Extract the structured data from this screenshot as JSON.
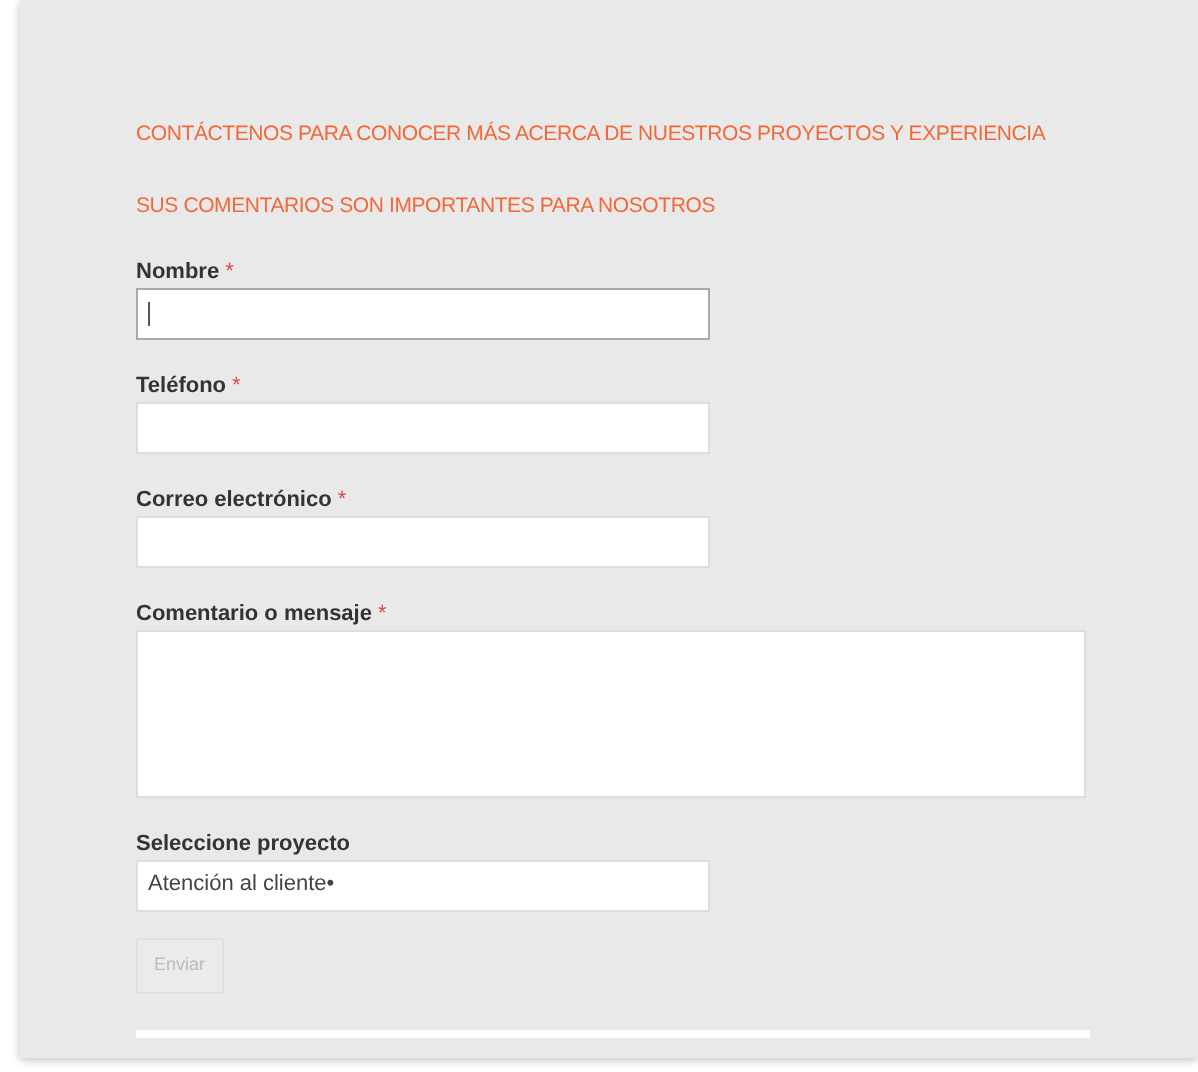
{
  "headings": [
    "CONTÁCTENOS PARA CONOCER MÁS ACERCA DE NUESTROS PROYECTOS Y EXPERIENCIA",
    "SUS COMENTARIOS SON IMPORTANTES PARA NOSOTROS"
  ],
  "fields": [
    {
      "kind": "text",
      "label": "Nombre",
      "required_mark": "*",
      "focused": true
    },
    {
      "kind": "text",
      "label": "Teléfono",
      "required_mark": "*",
      "focused": false
    },
    {
      "kind": "text",
      "label": "Correo electrónico",
      "required_mark": "*",
      "focused": false
    },
    {
      "kind": "textarea",
      "label": "Comentario o mensaje",
      "required_mark": "*",
      "focused": false
    },
    {
      "kind": "select",
      "label": "Seleccione proyecto",
      "focused": false,
      "value": "Atención al cliente•"
    }
  ],
  "submit": {
    "label": "Enviar",
    "disabled": true
  }
}
